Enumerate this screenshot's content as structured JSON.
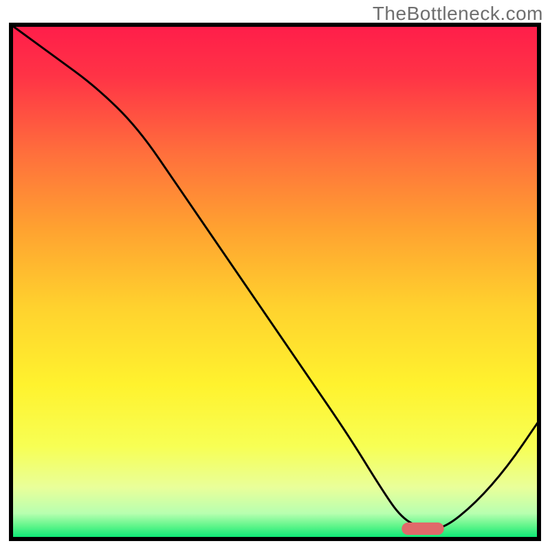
{
  "watermark": "TheBottleneck.com",
  "chart_data": {
    "type": "line",
    "title": "",
    "xlabel": "",
    "ylabel": "",
    "xlim": [
      0,
      100
    ],
    "ylim": [
      0,
      100
    ],
    "series": [
      {
        "name": "curve",
        "x": [
          0,
          8,
          16,
          24,
          32,
          40,
          48,
          56,
          64,
          70,
          74,
          78,
          82,
          88,
          94,
          100
        ],
        "y": [
          100,
          94,
          88,
          80,
          68,
          56,
          44,
          32,
          20,
          10,
          4,
          2,
          2,
          7,
          14,
          23
        ]
      }
    ],
    "marker": {
      "x_start": 74,
      "x_end": 82,
      "y": 2,
      "color": "#e06a6a"
    },
    "gradient_stops": [
      {
        "offset": 0.0,
        "color": "#ff1d4a"
      },
      {
        "offset": 0.1,
        "color": "#ff3346"
      },
      {
        "offset": 0.25,
        "color": "#ff6f3c"
      },
      {
        "offset": 0.4,
        "color": "#ffa330"
      },
      {
        "offset": 0.55,
        "color": "#ffd22e"
      },
      {
        "offset": 0.7,
        "color": "#fff22e"
      },
      {
        "offset": 0.82,
        "color": "#f7ff54"
      },
      {
        "offset": 0.9,
        "color": "#e9ff9a"
      },
      {
        "offset": 0.95,
        "color": "#b8ffb0"
      },
      {
        "offset": 0.975,
        "color": "#5ff58a"
      },
      {
        "offset": 1.0,
        "color": "#00e874"
      }
    ],
    "border_color": "#000000",
    "border_width": 6,
    "line_color": "#000000",
    "line_width": 3
  }
}
